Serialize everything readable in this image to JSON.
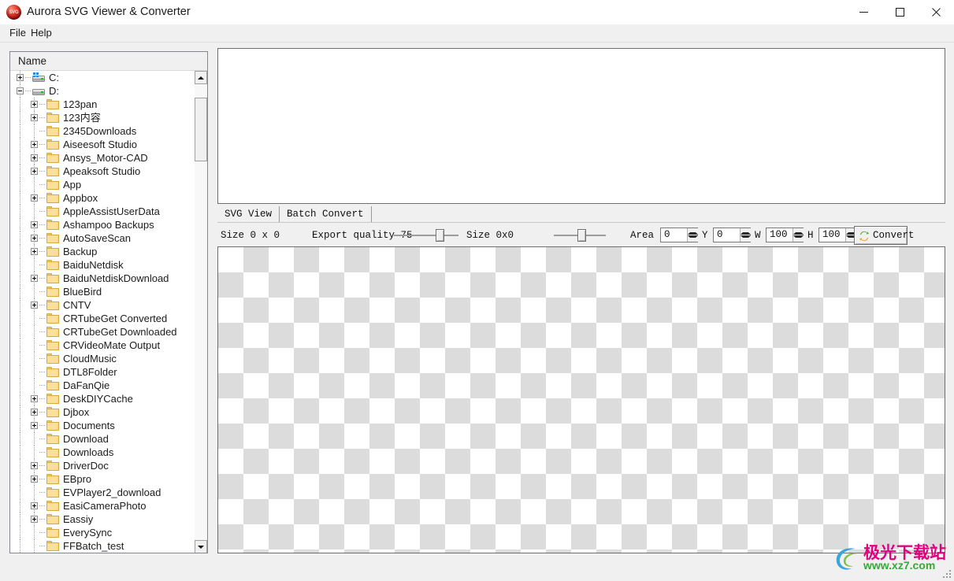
{
  "window": {
    "title": "Aurora SVG Viewer & Converter",
    "app_icon": "svg-sphere-icon",
    "controls": {
      "minimize": "minimize-icon",
      "maximize": "maximize-icon",
      "close": "close-icon"
    }
  },
  "menubar": {
    "items": [
      {
        "label": "File"
      },
      {
        "label": "Help"
      }
    ]
  },
  "tree": {
    "header": "Name",
    "nodes": [
      {
        "label": "C:",
        "type": "drive",
        "depth": 0,
        "toggle": "plus",
        "flag": true
      },
      {
        "label": "D:",
        "type": "drive",
        "depth": 0,
        "toggle": "minus",
        "flag": false
      },
      {
        "label": "123pan",
        "type": "folder",
        "depth": 1,
        "toggle": "plus"
      },
      {
        "label": "123内容",
        "type": "folder",
        "depth": 1,
        "toggle": "plus"
      },
      {
        "label": "2345Downloads",
        "type": "folder",
        "depth": 1,
        "toggle": "none"
      },
      {
        "label": "Aiseesoft Studio",
        "type": "folder",
        "depth": 1,
        "toggle": "plus"
      },
      {
        "label": "Ansys_Motor-CAD",
        "type": "folder",
        "depth": 1,
        "toggle": "plus"
      },
      {
        "label": "Apeaksoft Studio",
        "type": "folder",
        "depth": 1,
        "toggle": "plus"
      },
      {
        "label": "App",
        "type": "folder",
        "depth": 1,
        "toggle": "none"
      },
      {
        "label": "Appbox",
        "type": "folder",
        "depth": 1,
        "toggle": "plus"
      },
      {
        "label": "AppleAssistUserData",
        "type": "folder",
        "depth": 1,
        "toggle": "none"
      },
      {
        "label": "Ashampoo Backups",
        "type": "folder",
        "depth": 1,
        "toggle": "plus"
      },
      {
        "label": "AutoSaveScan",
        "type": "folder",
        "depth": 1,
        "toggle": "plus"
      },
      {
        "label": "Backup",
        "type": "folder",
        "depth": 1,
        "toggle": "plus"
      },
      {
        "label": "BaiduNetdisk",
        "type": "folder",
        "depth": 1,
        "toggle": "none"
      },
      {
        "label": "BaiduNetdiskDownload",
        "type": "folder",
        "depth": 1,
        "toggle": "plus"
      },
      {
        "label": "BlueBird",
        "type": "folder",
        "depth": 1,
        "toggle": "none"
      },
      {
        "label": "CNTV",
        "type": "folder",
        "depth": 1,
        "toggle": "plus"
      },
      {
        "label": "CRTubeGet Converted",
        "type": "folder",
        "depth": 1,
        "toggle": "none"
      },
      {
        "label": "CRTubeGet Downloaded",
        "type": "folder",
        "depth": 1,
        "toggle": "none"
      },
      {
        "label": "CRVideoMate Output",
        "type": "folder",
        "depth": 1,
        "toggle": "none"
      },
      {
        "label": "CloudMusic",
        "type": "folder",
        "depth": 1,
        "toggle": "none"
      },
      {
        "label": "DTL8Folder",
        "type": "folder",
        "depth": 1,
        "toggle": "none"
      },
      {
        "label": "DaFanQie",
        "type": "folder",
        "depth": 1,
        "toggle": "none"
      },
      {
        "label": "DeskDIYCache",
        "type": "folder",
        "depth": 1,
        "toggle": "plus"
      },
      {
        "label": "Djbox",
        "type": "folder",
        "depth": 1,
        "toggle": "plus"
      },
      {
        "label": "Documents",
        "type": "folder",
        "depth": 1,
        "toggle": "plus"
      },
      {
        "label": "Download",
        "type": "folder",
        "depth": 1,
        "toggle": "none"
      },
      {
        "label": "Downloads",
        "type": "folder",
        "depth": 1,
        "toggle": "none"
      },
      {
        "label": "DriverDoc",
        "type": "folder",
        "depth": 1,
        "toggle": "plus"
      },
      {
        "label": "EBpro",
        "type": "folder",
        "depth": 1,
        "toggle": "plus"
      },
      {
        "label": "EVPlayer2_download",
        "type": "folder",
        "depth": 1,
        "toggle": "none"
      },
      {
        "label": "EasiCameraPhoto",
        "type": "folder",
        "depth": 1,
        "toggle": "plus"
      },
      {
        "label": "Eassiy",
        "type": "folder",
        "depth": 1,
        "toggle": "plus"
      },
      {
        "label": "EverySync",
        "type": "folder",
        "depth": 1,
        "toggle": "none"
      },
      {
        "label": "FFBatch_test",
        "type": "folder",
        "depth": 1,
        "toggle": "none"
      }
    ],
    "scrollbar": {
      "up_arrow": "scroll-up-icon",
      "down_arrow": "scroll-down-icon",
      "thumb_top_pct": 3,
      "thumb_height_pct": 14
    }
  },
  "tabs": [
    {
      "label": "SVG View",
      "active": true
    },
    {
      "label": "Batch Convert",
      "active": false
    }
  ],
  "toolbar": {
    "size_label": "Size 0 x 0",
    "export_quality_label": "Export quality 75",
    "export_quality_value": 75,
    "quality_slider_pct": 75,
    "output_size_label": "Size 0x0",
    "scale_slider_pct": 55,
    "area_label": "Area X",
    "area_x": "0",
    "y_label": "Y",
    "area_y": "0",
    "w_label": "W",
    "area_w": "100",
    "h_label": "H",
    "area_h": "100",
    "convert_label": "Convert",
    "convert_icon": "convert-arrows-icon"
  },
  "canvas": {
    "background": "transparent-checkerboard",
    "checker_light": "#ffffff",
    "checker_dark": "#dcdcdc"
  },
  "watermark": {
    "title": "极光下载站",
    "url": "www.xz7.com",
    "title_color": "#e3007f",
    "url_color": "#37a838",
    "logo": "swirl-logo-icon"
  }
}
